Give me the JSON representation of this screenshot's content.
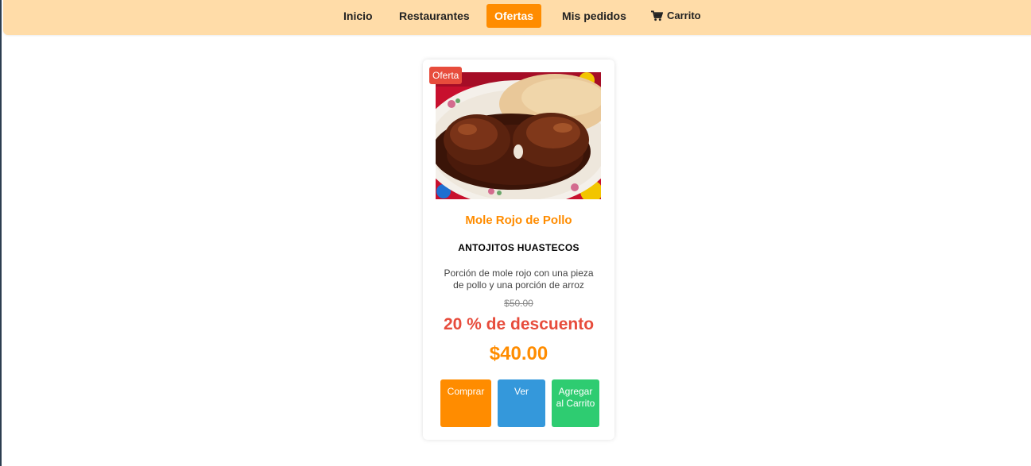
{
  "nav": {
    "items": [
      {
        "label": "Inicio"
      },
      {
        "label": "Restaurantes"
      },
      {
        "label": "Ofertas"
      },
      {
        "label": "Mis pedidos"
      }
    ],
    "cart_label": "Carrito",
    "cart_icon": "shopping-cart-icon",
    "active_color": "#ff8c00",
    "bar_color": "#ffdca8"
  },
  "card": {
    "badge": "Oferta",
    "image_alt": "mole-rojo-de-pollo-photo",
    "title": "Mole Rojo de Pollo",
    "restaurant": "ANTOJITOS HUASTECOS",
    "description": "Porción de mole rojo con una pieza de pollo y una porción de arroz",
    "old_price": "$50.00",
    "discount": "20 % de descuento",
    "price": "$40.00",
    "buttons": {
      "buy": "Comprar",
      "view": "Ver",
      "add_to_cart": "Agregar al Carrito"
    },
    "colors": {
      "buy": "#ff8c00",
      "view": "#3498db",
      "add_to_cart": "#2ecc71",
      "badge": "#e74c3c"
    }
  }
}
